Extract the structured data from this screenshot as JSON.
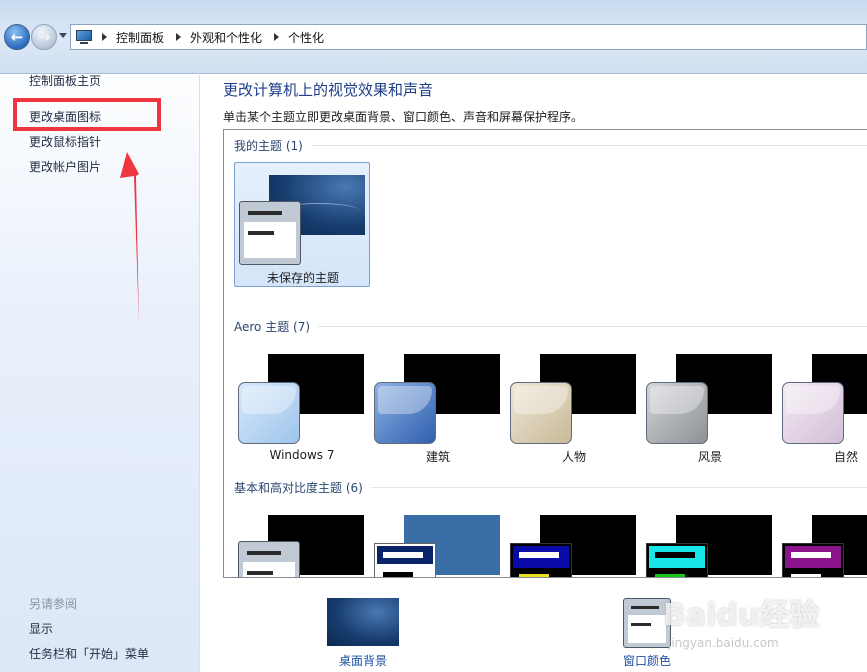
{
  "address_bar": {
    "breadcrumbs": [
      "控制面板",
      "外观和个性化",
      "个性化"
    ]
  },
  "sidebar": {
    "links": [
      "控制面板主页",
      "更改桌面图标",
      "更改鼠标指针",
      "更改帐户图片"
    ],
    "see_also_title": "另请参阅",
    "see_also_links": [
      "显示",
      "任务栏和「开始」菜单"
    ]
  },
  "main": {
    "title": "更改计算机上的视觉效果和声音",
    "description": "单击某个主题立即更改桌面背景、窗口颜色、声音和屏幕保护程序。",
    "groups": {
      "my": {
        "label": "我的主题 (1)",
        "themes": [
          "未保存的主题"
        ]
      },
      "aero": {
        "label": "Aero 主题 (7)",
        "themes": [
          "Windows 7",
          "建筑",
          "人物",
          "风景",
          "自然"
        ]
      },
      "basic": {
        "label": "基本和高对比度主题 (6)"
      }
    }
  },
  "bottom": {
    "desktop_background": "桌面背景",
    "window_color": "窗口颜色"
  },
  "watermark": {
    "logo": "Baidu经验",
    "url": "jingyan.baidu.com"
  },
  "colors": {
    "title_blue": "#1e3e8a",
    "annotation_red": "#ee3540",
    "aero_glass": [
      "#b9d7f5",
      "#4a7cc4",
      "#d8cdb4",
      "#a7a9ad",
      "#e4d5e6"
    ],
    "hc_colors": [
      {
        "bg": "#0a0aa8",
        "bar": "#e8e020"
      },
      {
        "bg": "#000000",
        "bar": "#19c419",
        "top": "#18e6e6"
      },
      {
        "bg": "#000000",
        "bar": "#ffffff",
        "top": "#8b138b"
      }
    ]
  }
}
